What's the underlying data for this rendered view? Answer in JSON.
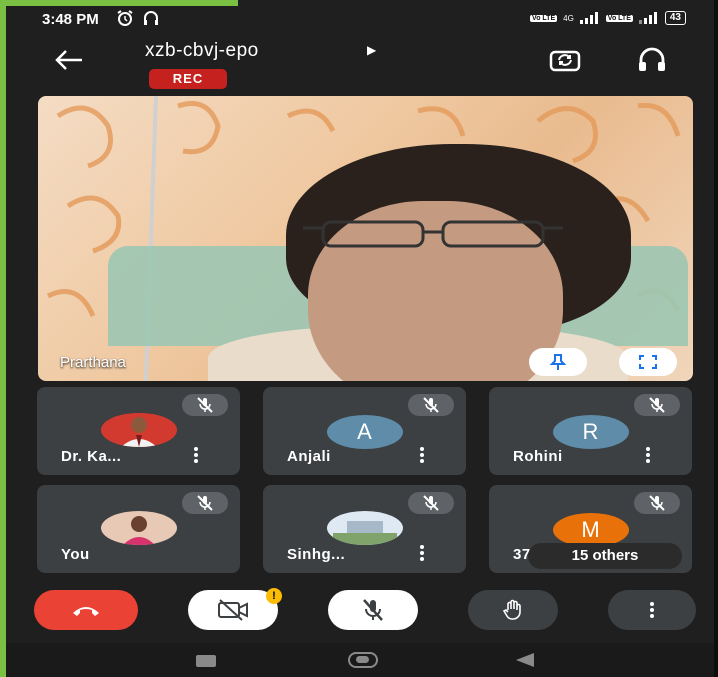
{
  "status": {
    "time": "3:48 PM",
    "battery": "43",
    "sim1": "Vo LTE",
    "sim2": "Vo LTE",
    "net": "4G"
  },
  "header": {
    "meeting_code": "xzb-cbvj-epo",
    "rec_label": "REC"
  },
  "main_video": {
    "name": "Prarthana"
  },
  "participants": [
    {
      "name": "Dr. Ka...",
      "avatar": "photo"
    },
    {
      "name": "Anjali",
      "avatar_letter": "A",
      "avatar_color": "#5f8ca8"
    },
    {
      "name": "Rohini",
      "avatar_letter": "R",
      "avatar_color": "#5f8ca8"
    },
    {
      "name": "You",
      "avatar": "photo"
    },
    {
      "name": "Sinhg...",
      "avatar": "photo"
    },
    {
      "name": "37",
      "avatar_letter": "M",
      "avatar_color": "#e8710a"
    }
  ],
  "others_label": "15 others",
  "colors": {
    "end_call": "#ea4335",
    "rec": "#c5221f",
    "tile": "#3c4043",
    "accent_badge": "#fbbc04"
  }
}
